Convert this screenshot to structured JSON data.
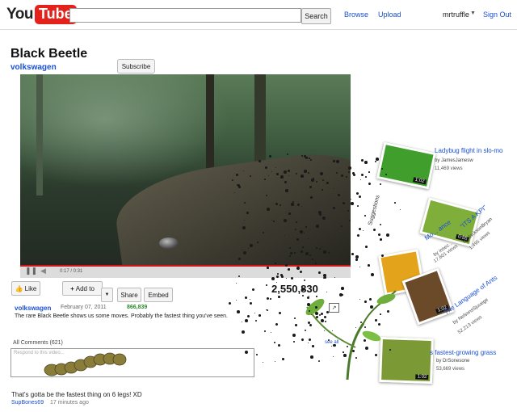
{
  "header": {
    "logo_you": "You",
    "logo_tube": "Tube",
    "search_placeholder": "",
    "search_button": "Search",
    "nav": {
      "browse": "Browse",
      "upload": "Upload"
    },
    "username": "mrtruffle",
    "signout": "Sign Out"
  },
  "video": {
    "title": "Black Beetle",
    "channel": "volkswagen",
    "subscribe": "Subscribe",
    "time": "0:17 / 0:31",
    "views": "2,550,830",
    "like_label": "Like",
    "addto_label": "Add to",
    "share_label": "Share",
    "embed_label": "Embed"
  },
  "description": {
    "user": "volkswagen",
    "date": "February 07, 2011",
    "likes": "866,839",
    "text": "The rare Black Beetle shows us some moves. Probably the fastest thing you've seen."
  },
  "comments": {
    "header": "All Comments (621)",
    "see_all": "see all",
    "placeholder": "Respond to this video...",
    "items": [
      {
        "text": "That's gotta be the fastest thing on 6 legs! XD",
        "user": "SupBones69",
        "time": "17 minutes ago"
      }
    ]
  },
  "suggestions_label": "Suggestions",
  "related": [
    {
      "title": "Ladybug flight in slo-mo",
      "by": "by JamesJamesw",
      "views": "11,469 views",
      "duration": "1:02",
      "color": "#3f9e2c"
    },
    {
      "title": "Mo... ance",
      "by": "by insec...",
      "views": "17,601 views",
      "duration": "0:55",
      "color": "#7fae3a"
    },
    {
      "title": "\"ITS A KPI\"",
      "by": "by JacksonBryan",
      "views": "1,495 views",
      "duration": "",
      "color": "#3b6b2a"
    },
    {
      "title": "The Language of Ants",
      "by": "by NelsonsSjuuege",
      "views": "52,213 views",
      "duration": "1:02",
      "color": "#e3a41c"
    },
    {
      "title": "s fastest-growing grass",
      "by": "by DrSonesone",
      "views": "53,669 views",
      "duration": "1:02",
      "color": "#7b9a36"
    }
  ],
  "colors": {
    "accent": "#1a4fd6",
    "brand": "#e3231b",
    "progress": "#cc1818",
    "likes": "#2a8a2a"
  },
  "icons": [
    "pause-icon",
    "volume-icon",
    "thumbs-up-icon",
    "plus-icon",
    "chevron-down-icon",
    "stats-icon"
  ]
}
